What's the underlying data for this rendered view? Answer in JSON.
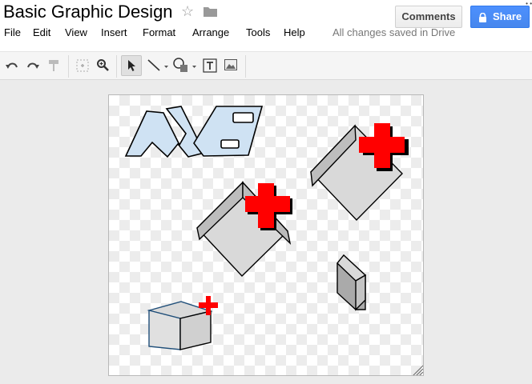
{
  "header": {
    "title": "Basic Graphic Design",
    "star_icon": "star-outline-icon",
    "folder_icon": "folder-icon"
  },
  "menu": [
    "File",
    "Edit",
    "View",
    "Insert",
    "Format",
    "Arrange",
    "Tools",
    "Help"
  ],
  "status": {
    "saved_text": "All changes saved in Drive"
  },
  "buttons": {
    "comments_label": "Comments",
    "share_label": "Share",
    "share_icon": "lock-icon"
  },
  "toolbar": {
    "tools": [
      "undo-icon",
      "redo-icon",
      "paint-format-icon",
      "select-region-icon",
      "zoom-icon",
      "select-arrow-icon",
      "line-icon",
      "shape-icon",
      "text-box-icon",
      "image-icon"
    ],
    "active_tool": "select-arrow-icon"
  },
  "colors": {
    "share_blue": "#4d90fe",
    "cross_red": "#ff0000",
    "logo_fill": "#cfe2f3",
    "box_gray": "#d9d9d9"
  }
}
